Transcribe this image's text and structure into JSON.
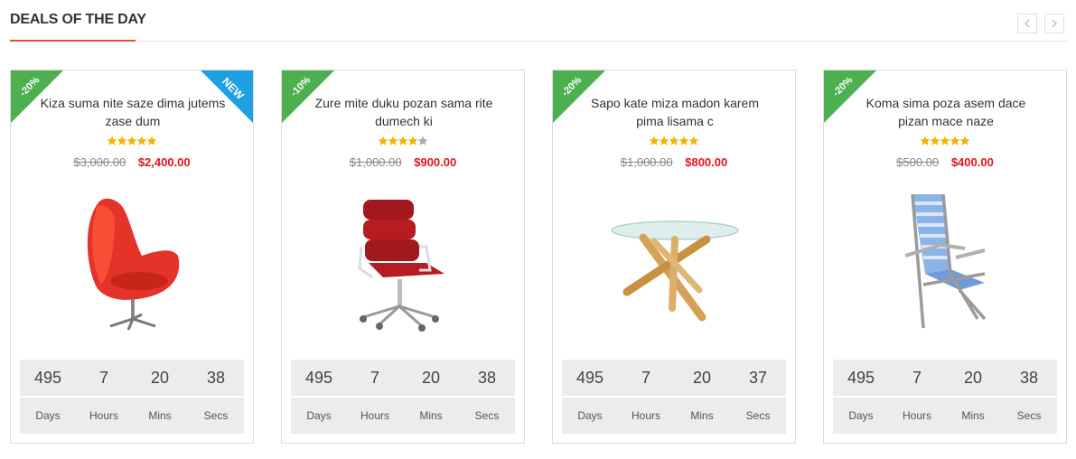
{
  "header": {
    "title": "DEALS OF THE DAY"
  },
  "nav": {
    "prev": "chevron-left-icon",
    "next": "chevron-right-icon"
  },
  "colors": {
    "accent": "#e74c3c",
    "discount_badge": "#4caf50",
    "new_badge": "#1ea1e3",
    "price": "#e4131c",
    "star": "#f5b301"
  },
  "countdown_labels": [
    "Days",
    "Hours",
    "Mins",
    "Secs"
  ],
  "products": [
    {
      "discount": "-20%",
      "badge_new": "NEW",
      "title": "Kiza suma nite saze dima jutems zase dum",
      "rating": 5,
      "old_price": "$3,000.00",
      "price": "$2,400.00",
      "image": "red-egg-chair",
      "countdown": [
        "495",
        "7",
        "20",
        "38"
      ]
    },
    {
      "discount": "-10%",
      "badge_new": "",
      "title": "Zure mite duku pozan sama rite dumech ki",
      "rating": 4,
      "old_price": "$1,000.00",
      "price": "$900.00",
      "image": "red-office-chair",
      "countdown": [
        "495",
        "7",
        "20",
        "38"
      ]
    },
    {
      "discount": "-20%",
      "badge_new": "",
      "title": "Sapo kate miza madon karem pima lisama c",
      "rating": 5,
      "old_price": "$1,000.00",
      "price": "$800.00",
      "image": "glass-table",
      "countdown": [
        "495",
        "7",
        "20",
        "37"
      ]
    },
    {
      "discount": "-20%",
      "badge_new": "",
      "title": "Koma sima poza asem dace pizan mace naze",
      "rating": 5,
      "old_price": "$500.00",
      "price": "$400.00",
      "image": "beach-chair",
      "countdown": [
        "495",
        "7",
        "20",
        "38"
      ]
    }
  ]
}
